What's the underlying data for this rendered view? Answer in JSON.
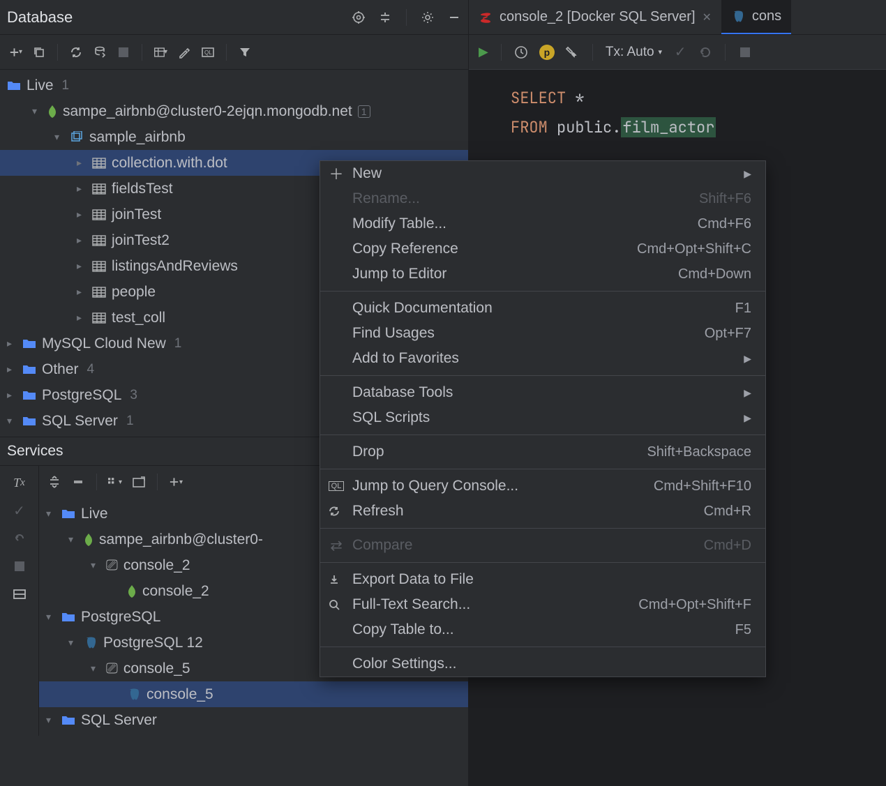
{
  "database_panel": {
    "title": "Database",
    "tree": {
      "live_label": "Live",
      "live_count": "1",
      "conn1": "sampe_airbnb@cluster0-2ejqn.mongodb.net",
      "conn1_badge": "1",
      "db1": "sample_airbnb",
      "collections": [
        "collection.with.dot",
        "fieldsTest",
        "joinTest",
        "joinTest2",
        "listingsAndReviews",
        "people",
        "test_coll"
      ],
      "mysql_label": "MySQL Cloud New",
      "mysql_count": "1",
      "other_label": "Other",
      "other_count": "4",
      "postgres_label": "PostgreSQL",
      "postgres_count": "3",
      "sqlserver_label": "SQL Server",
      "sqlserver_count": "1"
    }
  },
  "services_panel": {
    "title": "Services",
    "live_label": "Live",
    "conn": "sampe_airbnb@cluster0-",
    "console_a": "console_2",
    "console_a2": "console_2",
    "pg_group": "PostgreSQL",
    "pg_conn": "PostgreSQL 12",
    "console_b": "console_5",
    "console_b2": "console_5",
    "sqlserver": "SQL Server"
  },
  "editor_tabs": {
    "tab1": "console_2 [Docker SQL Server]",
    "tab2": "cons"
  },
  "editor_toolbar": {
    "tx": "Tx: Auto"
  },
  "editor_code": {
    "line1_kw": "SELECT",
    "line1_rest": "*",
    "line2_kw": "FROM",
    "line2_schema": "public.",
    "line2_table": "film_actor"
  },
  "context_menu": {
    "new": "New",
    "rename": "Rename...",
    "rename_sc": "Shift+F6",
    "modify": "Modify Table...",
    "modify_sc": "Cmd+F6",
    "copyref": "Copy Reference",
    "copyref_sc": "Cmd+Opt+Shift+C",
    "jump_editor": "Jump to Editor",
    "jump_editor_sc": "Cmd+Down",
    "quickdoc": "Quick Documentation",
    "quickdoc_sc": "F1",
    "find_usages": "Find Usages",
    "find_usages_sc": "Opt+F7",
    "favorites": "Add to Favorites",
    "db_tools": "Database Tools",
    "sql_scripts": "SQL Scripts",
    "drop": "Drop",
    "drop_sc": "Shift+Backspace",
    "jump_console": "Jump to Query Console...",
    "jump_console_sc": "Cmd+Shift+F10",
    "refresh": "Refresh",
    "refresh_sc": "Cmd+R",
    "compare": "Compare",
    "compare_sc": "Cmd+D",
    "export": "Export Data to File",
    "fts": "Full-Text Search...",
    "fts_sc": "Cmd+Opt+Shift+F",
    "copy_table": "Copy Table to...",
    "copy_table_sc": "F5",
    "color": "Color Settings..."
  }
}
